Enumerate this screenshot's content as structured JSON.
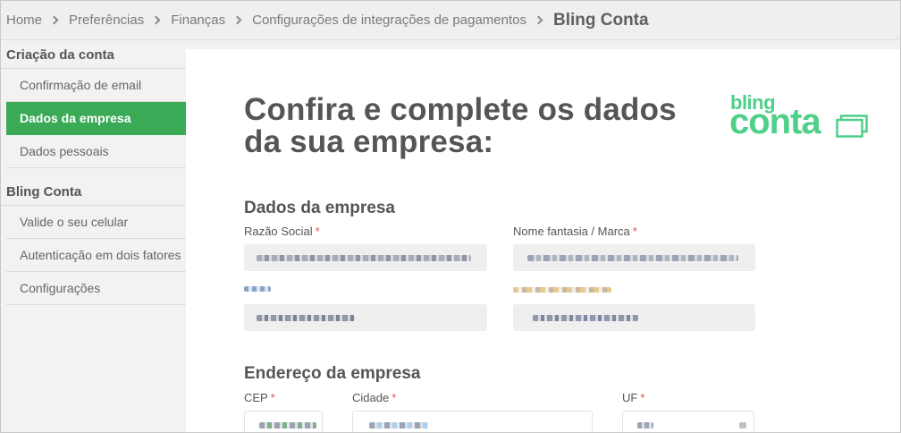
{
  "breadcrumb": {
    "items": [
      "Home",
      "Preferências",
      "Finanças",
      "Configurações de integrações de pagamentos"
    ],
    "current": "Bling Conta"
  },
  "sidebar": {
    "groups": [
      {
        "title": "Criação da conta",
        "items": [
          {
            "label": "Confirmação de email",
            "active": false
          },
          {
            "label": "Dados da empresa",
            "active": true
          },
          {
            "label": "Dados pessoais",
            "active": false
          }
        ]
      },
      {
        "title": "Bling Conta",
        "items": [
          {
            "label": "Valide o seu celular",
            "active": false
          },
          {
            "label": "Autenticação em dois fatores",
            "active": false
          },
          {
            "label": "Configurações",
            "active": false
          }
        ]
      }
    ]
  },
  "main": {
    "headline_line1": "Confira e complete os dados",
    "headline_line2": "da sua empresa:",
    "logo": {
      "top": "bling",
      "bottom": "conta",
      "color": "#4fcf8a"
    },
    "company_section": {
      "title": "Dados da empresa",
      "fields": {
        "razao_social": {
          "label": "Razão Social",
          "required": "*"
        },
        "nome_fantasia": {
          "label": "Nome fantasia / Marca",
          "required": "*"
        }
      }
    },
    "address_section": {
      "title": "Endereço da empresa",
      "fields": {
        "cep": {
          "label": "CEP",
          "required": "*"
        },
        "cidade": {
          "label": "Cidade",
          "required": "*"
        },
        "uf": {
          "label": "UF",
          "required": "*"
        }
      }
    }
  },
  "colors": {
    "accent_green": "#3aaa57",
    "logo_green": "#4fcf8a",
    "required_red": "#e05050"
  }
}
